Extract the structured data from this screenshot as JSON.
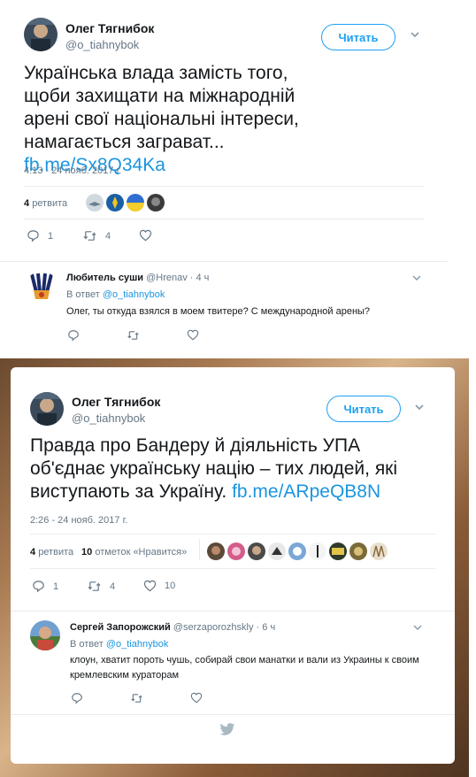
{
  "tweet1": {
    "author_name": "Олег Тягнибок",
    "author_handle": "@o_tiahnybok",
    "follow_label": "Читать",
    "text": "Українська влада замість того, щоби захищати на міжнародній арені свої національні інтереси, намагається заграват... ",
    "text_link": "fb.me/Sx8Q34Ka",
    "timestamp": "4:13 - 24 нояб. 2017 г.",
    "retweets_count": "4",
    "retweets_label": "ретвита",
    "actions": {
      "replies": "1",
      "retweets": "4",
      "likes": ""
    }
  },
  "reply1": {
    "author_name": "Любитель суши",
    "author_handle": "@Hrenav",
    "time_ago": "· 4 ч",
    "in_reply_prefix": "В ответ",
    "in_reply_handle": "@o_tiahnybok",
    "text": "Олег, ты откуда взялся в моем твитере? С международной арены?"
  },
  "tweet2": {
    "author_name": "Олег Тягнибок",
    "author_handle": "@o_tiahnybok",
    "follow_label": "Читать",
    "text": "Правда про Бандеру й діяльність УПА об'єднає українську націю – тих людей, які виступають за Україну. ",
    "text_link": "fb.me/ARpeQB8N",
    "timestamp": "2:26 - 24 нояб. 2017 г.",
    "retweets_count": "4",
    "retweets_label": "ретвита",
    "likes_count": "10",
    "likes_label": "отметок «Нравится»",
    "actions": {
      "replies": "1",
      "retweets": "4",
      "likes": "10"
    }
  },
  "reply2": {
    "author_name": "Сергей Запорожский",
    "author_handle": "@serzaporozhskly",
    "time_ago": "· 6 ч",
    "in_reply_prefix": "В ответ",
    "in_reply_handle": "@o_tiahnybok",
    "text": "клоун, хватит пороть чушь, собирай свои манатки и вали из Украины к своим кремлевским кураторам"
  },
  "colors": {
    "accent": "#1da1f2",
    "link": "#1b95e0",
    "muted": "#657786",
    "text": "#14171a"
  }
}
